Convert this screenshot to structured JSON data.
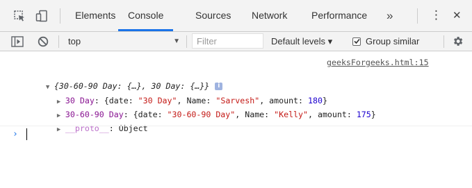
{
  "tabs": [
    {
      "label": "Elements",
      "active": false
    },
    {
      "label": "Console",
      "active": true
    },
    {
      "label": "Sources",
      "active": false
    },
    {
      "label": "Network",
      "active": false
    },
    {
      "label": "Performance",
      "active": false
    }
  ],
  "tabbar": {
    "more_label": "»",
    "menu_label": "⋮",
    "close_label": "✕"
  },
  "toolbar": {
    "context": "top",
    "filter_placeholder": "Filter",
    "filter_value": "",
    "levels_label": "Default levels ▾",
    "group_similar_label": "Group similar",
    "group_similar_checked": true
  },
  "console": {
    "source_link": "geeksForgeeks.html:15",
    "summary": "{30-60-90 Day: {…}, 30 Day: {…}}",
    "info_badge": "i",
    "entries": [
      {
        "key": "30 Day",
        "sep": ": {",
        "p1": "date",
        "v1": "\"30 Day\"",
        "p2": "Name",
        "v2": "\"Sarvesh\"",
        "p3": "amount",
        "v3": "180"
      },
      {
        "key": "30-60-90 Day",
        "sep": ": {",
        "p1": "date",
        "v1": "\"30-60-90 Day\"",
        "p2": "Name",
        "v2": "\"Kelly\"",
        "p3": "amount",
        "v3": "175"
      }
    ],
    "proto_key": "__proto__",
    "proto_value": ": Object",
    "prompt": "›"
  },
  "colors": {
    "accent": "#1a73e8",
    "property": "#881391",
    "string": "#c41a16",
    "number": "#1c00cf"
  }
}
